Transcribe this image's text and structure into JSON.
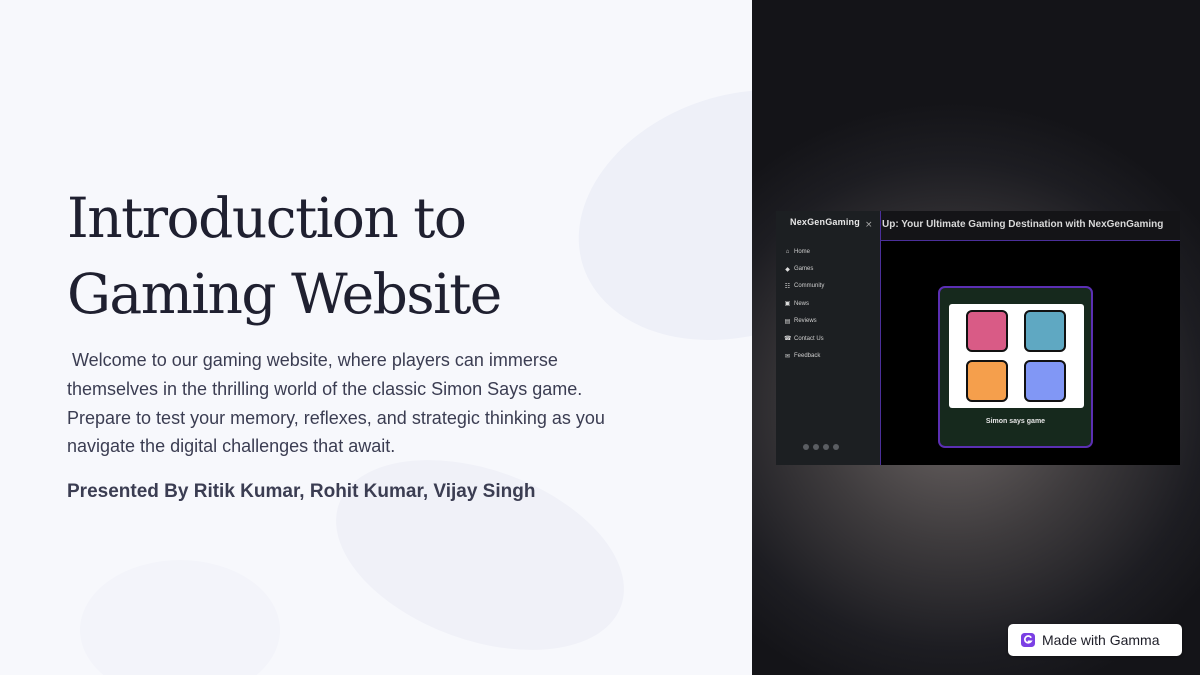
{
  "slide": {
    "title_lines": [
      "Introduction to",
      "Gaming Website"
    ],
    "body_lines": [
      " Welcome to our gaming website, where players can immerse",
      "themselves in the thrilling world of the classic Simon Says game.",
      "Prepare to test your memory, reflexes, and strategic thinking as you",
      "navigate the digital challenges that await."
    ],
    "presenters": "Presented By Ritik Kumar, Rohit Kumar, Vijay Singh"
  },
  "screenshot": {
    "logo": "NexGenGaming",
    "close_glyph": "×",
    "header_title": "Up: Your Ultimate Gaming Destination with NexGenGaming",
    "nav": [
      {
        "icon": "home-icon",
        "glyph": "⌂",
        "label": "Home"
      },
      {
        "icon": "gamepad-icon",
        "glyph": "◆",
        "label": "Games"
      },
      {
        "icon": "community-icon",
        "glyph": "☷",
        "label": "Community"
      },
      {
        "icon": "news-icon",
        "glyph": "▣",
        "label": "News"
      },
      {
        "icon": "reviews-icon",
        "glyph": "▤",
        "label": "Reviews"
      },
      {
        "icon": "phone-icon",
        "glyph": "☎",
        "label": "Contact Us"
      },
      {
        "icon": "feedback-icon",
        "glyph": "✉",
        "label": "Feedback"
      }
    ],
    "game_label": "Simon says game",
    "pad_colors": {
      "top_left": "#d95b86",
      "top_right": "#5fa8c2",
      "bottom_left": "#f59f4c",
      "bottom_right": "#8197f5"
    }
  },
  "badge": {
    "label": "Made with Gamma"
  }
}
